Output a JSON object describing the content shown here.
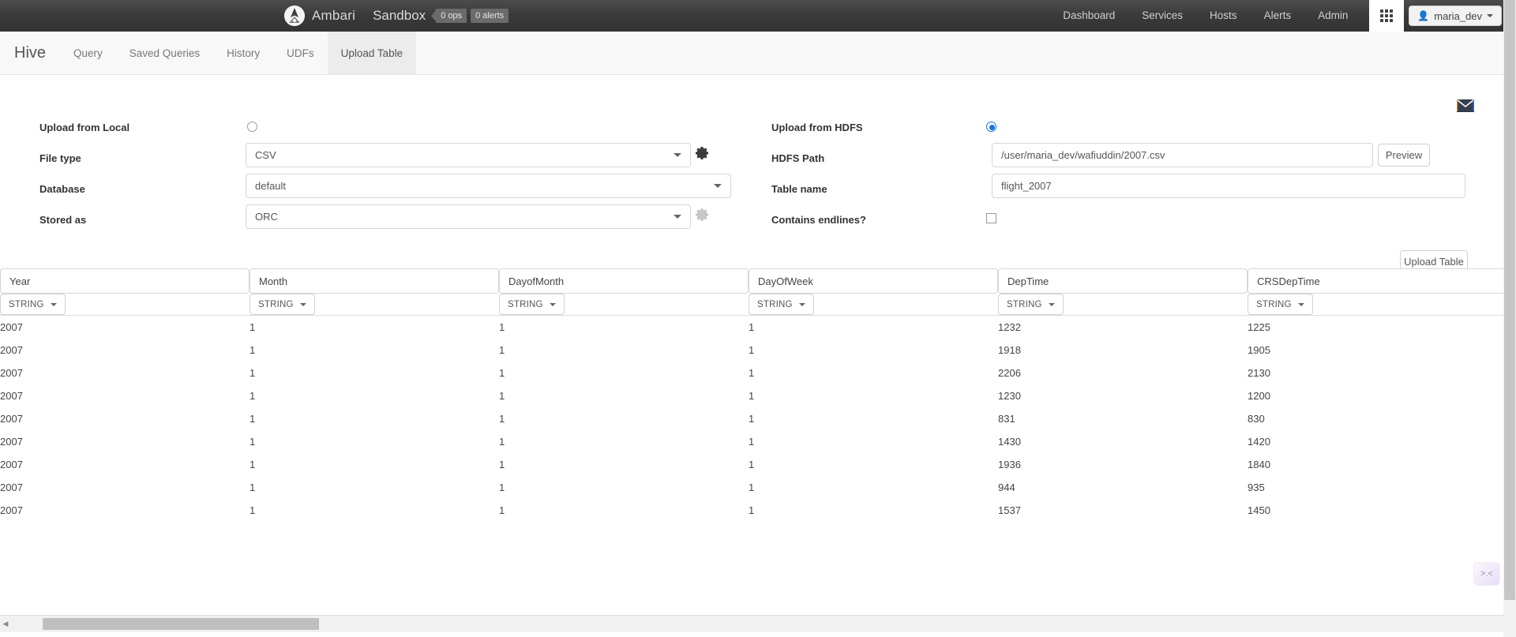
{
  "topnav": {
    "brand": "Ambari",
    "cluster": "Sandbox",
    "ops_badge": "0 ops",
    "alerts_badge": "0 alerts",
    "links": [
      "Dashboard",
      "Services",
      "Hosts",
      "Alerts",
      "Admin"
    ],
    "grid_icon": "grid-apps-icon",
    "user": "maria_dev",
    "user_icon": "user-icon"
  },
  "viewbar": {
    "title": "Hive",
    "tabs": [
      {
        "label": "Query",
        "active": false
      },
      {
        "label": "Saved Queries",
        "active": false
      },
      {
        "label": "History",
        "active": false
      },
      {
        "label": "UDFs",
        "active": false
      },
      {
        "label": "Upload Table",
        "active": true
      }
    ]
  },
  "mail_icon": "envelope-icon",
  "form": {
    "upload_local_label": "Upload from Local",
    "upload_local_selected": false,
    "file_type_label": "File type",
    "file_type_value": "CSV",
    "file_type_gear": "gear-icon",
    "database_label": "Database",
    "database_value": "default",
    "stored_as_label": "Stored as",
    "stored_as_value": "ORC",
    "stored_as_gear": "gear-icon-disabled",
    "upload_hdfs_label": "Upload from HDFS",
    "upload_hdfs_selected": true,
    "hdfs_path_label": "HDFS Path",
    "hdfs_path_value": "/user/maria_dev/wafiuddin/2007.csv",
    "preview_button": "Preview",
    "table_name_label": "Table name",
    "table_name_value": "flight_2007",
    "contains_endlines_label": "Contains endlines?",
    "contains_endlines_checked": false,
    "upload_table_button": "Upload Table"
  },
  "table": {
    "columns": [
      "Year",
      "Month",
      "DayofMonth",
      "DayOfWeek",
      "DepTime",
      "CRSDepTime"
    ],
    "types": [
      "STRING",
      "STRING",
      "STRING",
      "STRING",
      "STRING",
      "STRING"
    ],
    "rows": [
      [
        "2007",
        "1",
        "1",
        "1",
        "1232",
        "1225"
      ],
      [
        "2007",
        "1",
        "1",
        "1",
        "1918",
        "1905"
      ],
      [
        "2007",
        "1",
        "1",
        "1",
        "2206",
        "2130"
      ],
      [
        "2007",
        "1",
        "1",
        "1",
        "1230",
        "1200"
      ],
      [
        "2007",
        "1",
        "1",
        "1",
        "831",
        "830"
      ],
      [
        "2007",
        "1",
        "1",
        "1",
        "1430",
        "1420"
      ],
      [
        "2007",
        "1",
        "1",
        "1",
        "1936",
        "1840"
      ],
      [
        "2007",
        "1",
        "1",
        "1",
        "944",
        "935"
      ],
      [
        "2007",
        "1",
        "1",
        "1",
        "1537",
        "1450"
      ]
    ]
  },
  "scrollbars": {
    "h_left_arrow": "chevron-left-icon",
    "h_right_arrow": "chevron-right-icon"
  },
  "chat_widget": {
    "glyph": ">.<"
  },
  "colors": {
    "nav_bg": "#3a3a3a",
    "accent_blue": "#1177dd",
    "tab_active_bg": "#ececec",
    "field_border": "#d6d6d6"
  }
}
